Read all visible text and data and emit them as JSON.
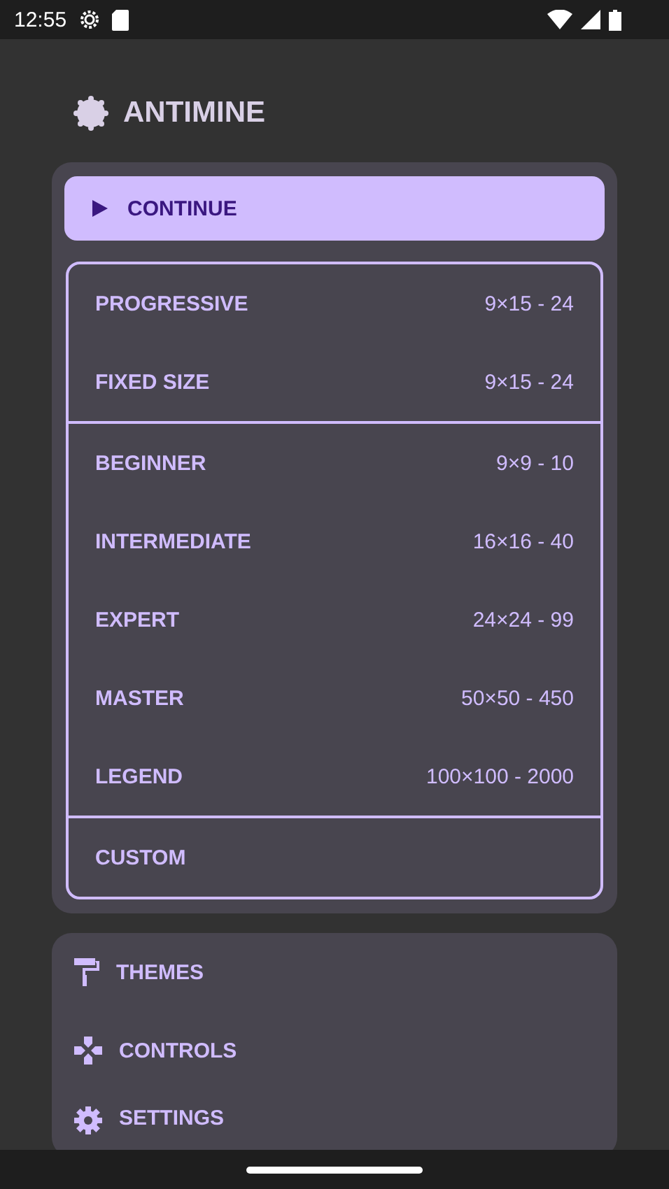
{
  "status_bar": {
    "time": "12:55"
  },
  "app_title": "ANTIMINE",
  "continue_button": {
    "label": "CONTINUE"
  },
  "mode_groups": [
    [
      {
        "label": "PROGRESSIVE",
        "value": "9×15 - 24"
      },
      {
        "label": "FIXED SIZE",
        "value": "9×15 - 24"
      }
    ],
    [
      {
        "label": "BEGINNER",
        "value": "9×9 - 10"
      },
      {
        "label": "INTERMEDIATE",
        "value": "16×16 - 40"
      },
      {
        "label": "EXPERT",
        "value": "24×24 - 99"
      },
      {
        "label": "MASTER",
        "value": "50×50 - 450"
      },
      {
        "label": "LEGEND",
        "value": "100×100 - 2000"
      }
    ],
    [
      {
        "label": "CUSTOM"
      }
    ]
  ],
  "menu": [
    {
      "kind": "themes",
      "label": "THEMES"
    },
    {
      "kind": "controls",
      "label": "CONTROLS"
    },
    {
      "kind": "settings",
      "label": "SETTINGS"
    }
  ]
}
